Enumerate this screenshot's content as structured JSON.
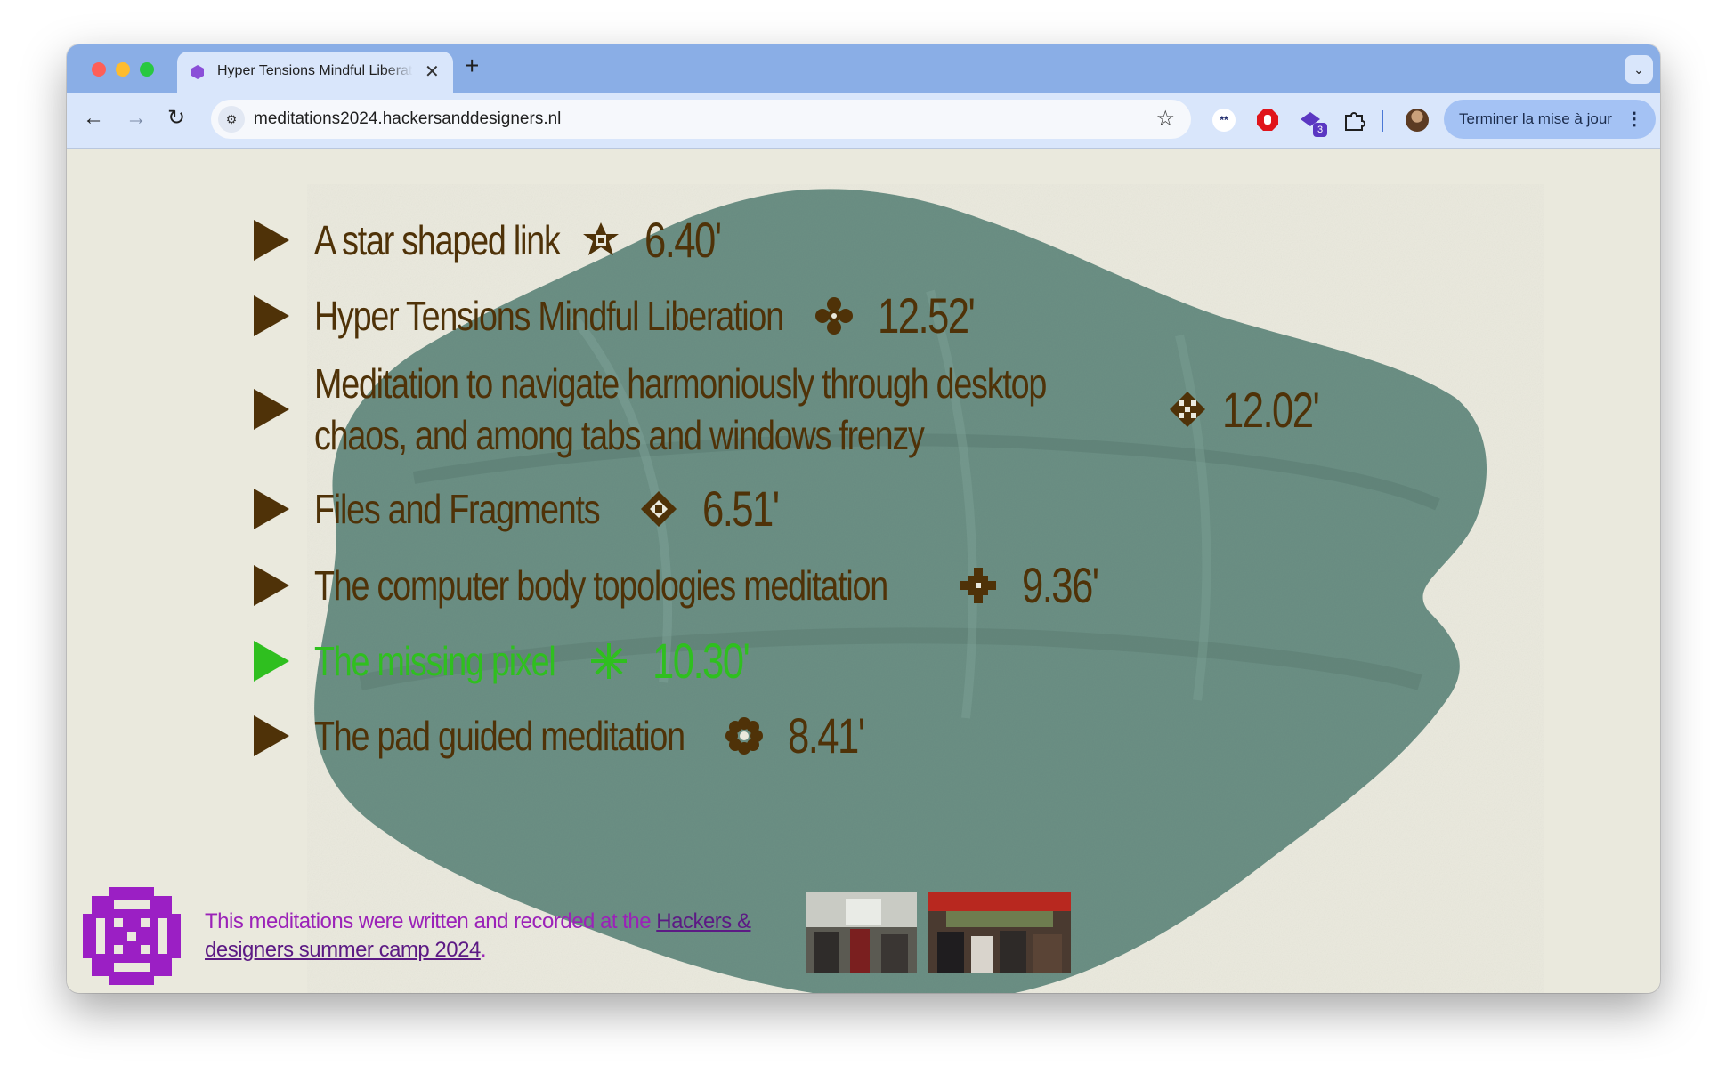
{
  "browser": {
    "tab_title": "Hyper Tensions Mindful Liberation",
    "tab_close": "✕",
    "new_tab": "+",
    "tab_search": "⌄",
    "back": "←",
    "forward": "→",
    "reload": "↻",
    "url": "meditations2024.hackersanddesigners.nl",
    "bookmark": "☆",
    "extensions": [
      {
        "name": "asterisk-extension",
        "glyph": "**"
      },
      {
        "name": "ublock-extension",
        "glyph": ""
      },
      {
        "name": "purple-extension",
        "badge": "3"
      },
      {
        "name": "puzzle-extension",
        "glyph": ""
      }
    ],
    "update_button": "Terminer la mise à jour",
    "update_menu": "⋮",
    "accent_color": "#8aaee6"
  },
  "meditations": [
    {
      "title": "A star shaped link",
      "duration": "6.40'",
      "symbol": "star-ornament-icon"
    },
    {
      "title": "Hyper Tensions Mindful Liberation",
      "duration": "12.52'",
      "symbol": "flower-ornament-icon"
    },
    {
      "title": "Meditation to navigate harmoniously through desktop chaos, and among tabs and windows frenzy",
      "duration": "12.02'",
      "symbol": "checker-ornament-icon"
    },
    {
      "title": "Files and Fragments",
      "duration": "6.51'",
      "symbol": "diamond-ornament-icon"
    },
    {
      "title": "The computer body topologies meditation",
      "duration": "9.36'",
      "symbol": "cross-ornament-icon"
    },
    {
      "title": "The missing pixel",
      "duration": "10.30'",
      "symbol": "snowflake-ornament-icon",
      "active": true
    },
    {
      "title": "The pad guided meditation",
      "duration": "8.41'",
      "symbol": "rosette-ornament-icon"
    }
  ],
  "credits": {
    "text_before": "This meditations were written and recorded at the ",
    "link_text": "Hackers & designers summer camp 2024",
    "text_after": "."
  },
  "colors": {
    "text": "#4f3208",
    "active": "#2fbf1f",
    "background": "#eae9dd",
    "pillow": "#6b8f84",
    "credits": "#9b22b8"
  }
}
